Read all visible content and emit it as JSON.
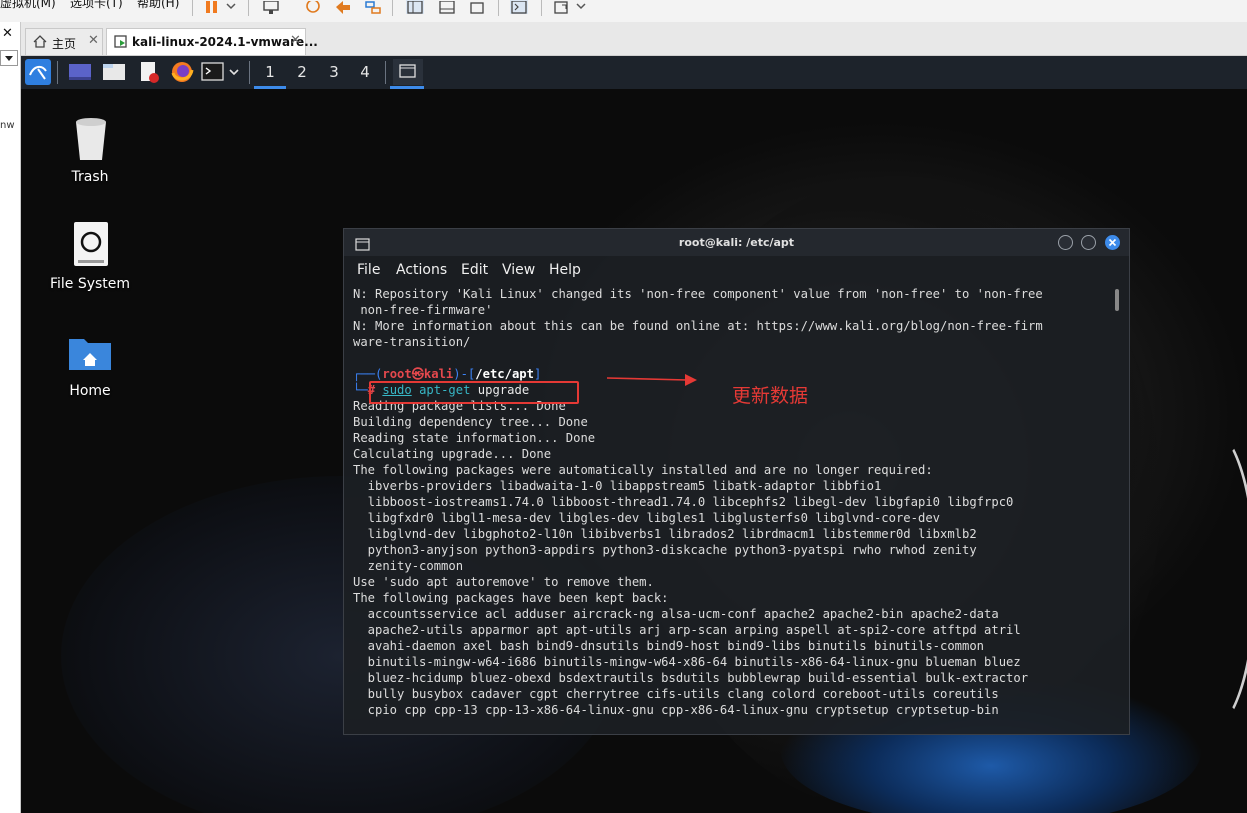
{
  "vm_menubar": {
    "items": [
      "虚拟机(M)",
      "选项卡(T)",
      "帮助(H)"
    ]
  },
  "tabs": [
    {
      "label": "主页",
      "icon": "home-icon"
    },
    {
      "label": "kali-linux-2024.1-vmware...",
      "icon": "vm-icon"
    }
  ],
  "left_panel": {
    "truncated_text": "nw"
  },
  "kali_panel": {
    "workspaces": [
      "1",
      "2",
      "3",
      "4"
    ]
  },
  "desktop": {
    "icons": [
      {
        "label": "Trash",
        "icon": "trash-icon"
      },
      {
        "label": "File System",
        "icon": "drive-icon"
      },
      {
        "label": "Home",
        "icon": "home-folder-icon"
      }
    ]
  },
  "terminal": {
    "title": "root@kali: /etc/apt",
    "menu": [
      "File",
      "Actions",
      "Edit",
      "View",
      "Help"
    ],
    "lines": [
      "N: Repository 'Kali Linux' changed its 'non-free component' value from 'non-free' to 'non-free",
      " non-free-firmware'",
      "N: More information about this can be found online at: https://www.kali.org/blog/non-free-firm",
      "ware-transition/",
      "",
      "",
      "",
      "Reading package lists... Done",
      "Building dependency tree... Done",
      "Reading state information... Done",
      "Calculating upgrade... Done",
      "The following packages were automatically installed and are no longer required:",
      "  ibverbs-providers libadwaita-1-0 libappstream5 libatk-adaptor libbfio1",
      "  libboost-iostreams1.74.0 libboost-thread1.74.0 libcephfs2 libegl-dev libgfapi0 libgfrpc0",
      "  libgfxdr0 libgl1-mesa-dev libgles-dev libgles1 libglusterfs0 libglvnd-core-dev",
      "  libglvnd-dev libgphoto2-l10n libibverbs1 librados2 librdmacm1 libstemmer0d libxmlb2",
      "  python3-anyjson python3-appdirs python3-diskcache python3-pyatspi rwho rwhod zenity",
      "  zenity-common",
      "Use 'sudo apt autoremove' to remove them.",
      "The following packages have been kept back:",
      "  accountsservice acl adduser aircrack-ng alsa-ucm-conf apache2 apache2-bin apache2-data",
      "  apache2-utils apparmor apt apt-utils arj arp-scan arping aspell at-spi2-core atftpd atril",
      "  avahi-daemon axel bash bind9-dnsutils bind9-host bind9-libs binutils binutils-common",
      "  binutils-mingw-w64-i686 binutils-mingw-w64-x86-64 binutils-x86-64-linux-gnu blueman bluez",
      "  bluez-hcidump bluez-obexd bsdextrautils bsdutils bubblewrap build-essential bulk-extractor",
      "  bully busybox cadaver cgpt cherrytree cifs-utils clang colord coreboot-utils coreutils",
      "  cpio cpp cpp-13 cpp-13-x86-64-linux-gnu cpp-x86-64-linux-gnu cryptsetup cryptsetup-bin"
    ],
    "prompt": {
      "open": "┌──(",
      "user_host": "root㉿kali",
      "mid": ")-[",
      "path": "/etc/apt",
      "close": "]",
      "corner": "└─",
      "hash": "# ",
      "sudo": "sudo",
      "cmd": "apt-get",
      "arg": "upgrade"
    }
  },
  "annotation": {
    "label": "更新数据",
    "color": "#e53935"
  },
  "colors": {
    "prompt_user": "#e5484d",
    "prompt_frame": "#3b82f6",
    "command": "#37b7c6"
  }
}
